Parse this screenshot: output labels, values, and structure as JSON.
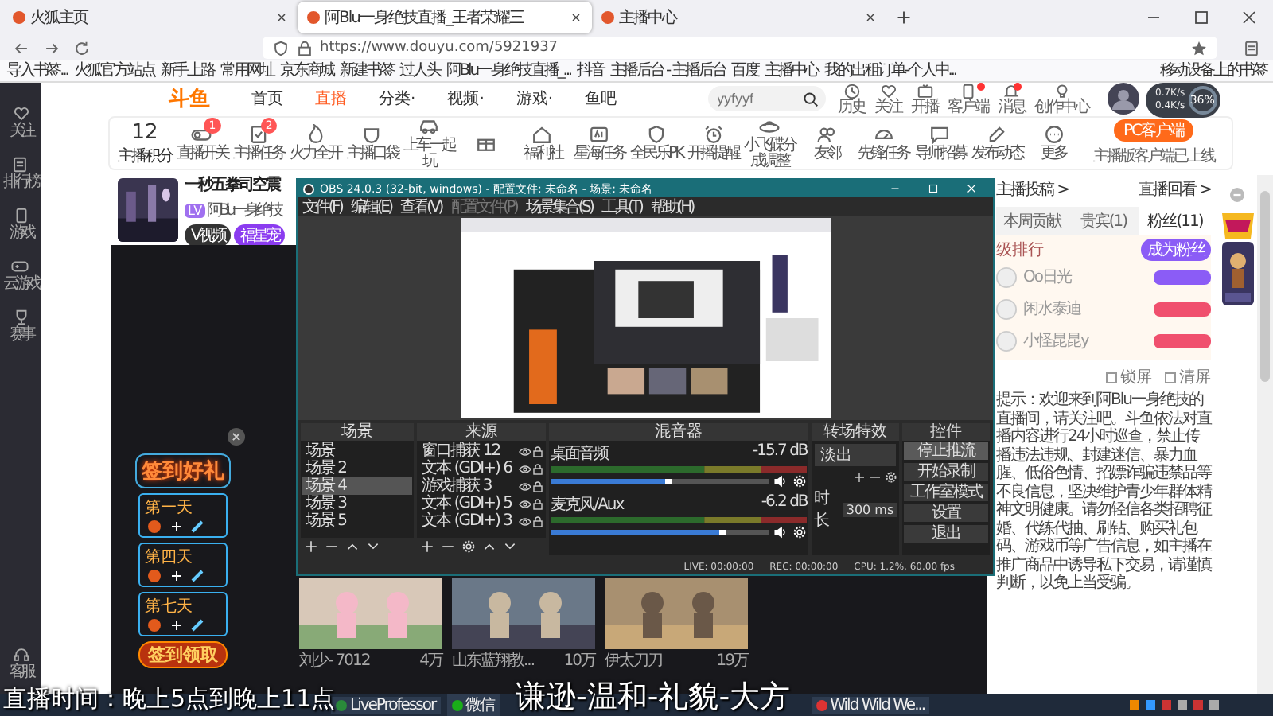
{
  "browser": {
    "tabs": [
      {
        "label": "火狐主页",
        "selected": false
      },
      {
        "label": "阿Blu一身绝技直播_王者荣耀三",
        "selected": true
      },
      {
        "label": "主播中心",
        "selected": false
      }
    ],
    "url": "https://www.douyu.com/5921937",
    "bookmarks": [
      "导入书签...",
      "火狐官方站点",
      "新手上路",
      "常用网址",
      "京东商城",
      "新建书签",
      "过人头",
      "阿Blu一身绝技直播_...",
      "抖音",
      "主播后台 - 主播后台",
      "百度",
      "主播中心",
      "我的出租订单-个人中..."
    ],
    "mobile_bookmarks": "移动设备上的书签"
  },
  "site": {
    "logo": "斗鱼",
    "nav": [
      {
        "label": "首页",
        "selected": false
      },
      {
        "label": "直播",
        "selected": true
      },
      {
        "label": "分类·",
        "selected": false
      },
      {
        "label": "视频·",
        "selected": false
      },
      {
        "label": "游戏·",
        "selected": false
      },
      {
        "label": "鱼吧",
        "selected": false
      }
    ],
    "search": {
      "placeholder": "yyfyyf"
    },
    "header_links": [
      {
        "label": "历史",
        "badge": false
      },
      {
        "label": "关注",
        "badge": false
      },
      {
        "label": "开播",
        "badge": false
      },
      {
        "label": "客户端",
        "badge": true
      },
      {
        "label": "消息",
        "badge": true
      },
      {
        "label": "创作中心",
        "badge": false
      }
    ]
  },
  "sidebar": {
    "items": [
      {
        "label": "关注"
      },
      {
        "label": "排行榜"
      },
      {
        "label": "游戏"
      },
      {
        "label": "云游戏"
      },
      {
        "label": "赛事"
      },
      {
        "label": "客服"
      }
    ]
  },
  "toolbar": {
    "score": "12",
    "score_label": "主播积分",
    "items": [
      {
        "kind": "labeled",
        "label": "直播开关",
        "badge": "1"
      },
      {
        "kind": "labeled",
        "label": "主播任务",
        "badge": "2"
      },
      {
        "kind": "labeled",
        "label": "火力全开"
      },
      {
        "kind": "labeled",
        "label": "主播口袋"
      },
      {
        "kind": "labeled",
        "label": "上车一起玩"
      },
      {
        "kind": "icon"
      },
      {
        "kind": "labeled",
        "label": "福利社"
      },
      {
        "kind": "labeled",
        "label": "星海任务"
      },
      {
        "kind": "labeled",
        "label": "全民乐PK"
      },
      {
        "kind": "labeled",
        "label": "开播提醒"
      },
      {
        "kind": "labeled",
        "label": "小飞碟分成调整"
      },
      {
        "kind": "labeled",
        "label": "友邻"
      },
      {
        "kind": "labeled",
        "label": "先锋任务"
      },
      {
        "kind": "labeled",
        "label": "导师招募"
      },
      {
        "kind": "labeled",
        "label": "发布动态"
      },
      {
        "kind": "labeled",
        "label": "更多"
      }
    ],
    "client_button": "PC客户端",
    "client_note": "主播版客户端已上线"
  },
  "room": {
    "title": "一秒五拳司空震",
    "streamer": "阿Blu一身绝技",
    "level": "LV",
    "tags": [
      "V视频",
      "福星宠"
    ]
  },
  "gift_panel": {
    "title": "签到好礼",
    "days": [
      "第一天",
      "第四天",
      "第七天"
    ],
    "button": "签到领取"
  },
  "recommended": [
    {
      "author": "刘少- 7012",
      "views": "4万"
    },
    {
      "author": "山东蓝翔教...",
      "views": "10万"
    },
    {
      "author": "伊太刀刀",
      "views": "19万"
    }
  ],
  "obs": {
    "title": "OBS 24.0.3 (32-bit, windows) - 配置文件: 未命名 - 场景: 未命名",
    "menu": [
      {
        "label": "文件(F)",
        "disabled": false
      },
      {
        "label": "编辑(E)",
        "disabled": false
      },
      {
        "label": "查看(V)",
        "disabled": false
      },
      {
        "label": "配置文件(P)",
        "disabled": true
      },
      {
        "label": "场景集合(S)",
        "disabled": false
      },
      {
        "label": "工具(T)",
        "disabled": false
      },
      {
        "label": "帮助(H)",
        "disabled": false
      }
    ],
    "docks": [
      "场景",
      "来源",
      "混音器",
      "转场特效",
      "控件"
    ],
    "scenes": [
      {
        "label": "场景",
        "selected": false
      },
      {
        "label": "场景 2",
        "selected": false
      },
      {
        "label": "场景 4",
        "selected": true
      },
      {
        "label": "场景 3",
        "selected": false
      },
      {
        "label": "场景 5",
        "selected": false
      }
    ],
    "sources": [
      "窗口捕获 12",
      "文本 (GDI+) 6",
      "游戏捕获 3",
      "文本 (GDI+) 5",
      "文本 (GDI+) 3"
    ],
    "channels": [
      {
        "name": "桌面音频",
        "reading": "-15.7 dB",
        "level": 0.55
      },
      {
        "name": "麦克风/Aux",
        "reading": "-6.2 dB",
        "level": 0.8
      }
    ],
    "transition": {
      "value": "淡出",
      "duration_label": "时长",
      "duration": "300 ms"
    },
    "controls": [
      {
        "label": "停止推流",
        "active": true
      },
      {
        "label": "开始录制",
        "active": false
      },
      {
        "label": "工作室模式",
        "active": false
      },
      {
        "label": "设置",
        "active": false
      },
      {
        "label": "退出",
        "active": false
      }
    ],
    "status": [
      "LIVE: 00:00:00",
      "REC: 00:00:00",
      "CPU: 1.2%, 60.00 fps"
    ]
  },
  "right_panel": {
    "links": [
      "主播投稿 >",
      "直播回看 >"
    ],
    "tabs": [
      {
        "label": "本周贡献",
        "selected": false
      },
      {
        "label": "贵宾(1)",
        "selected": false
      },
      {
        "label": "粉丝(11)",
        "selected": true
      }
    ],
    "rank_title": "级排行",
    "join_button": "成为粉丝",
    "fans": [
      {
        "name": "Oo日光",
        "color": "#8b5cf6"
      },
      {
        "name": "闲水泰迪",
        "color": "#f0506e"
      },
      {
        "name": "小怪昆昆y",
        "color": "#f0506e"
      }
    ],
    "chat_options": [
      {
        "label": "锁屏",
        "checked": false
      },
      {
        "label": "清屏",
        "checked": false
      }
    ],
    "notice": "提示：欢迎来到阿Blu一身绝技的直播间，请关注吧。斗鱼依法对直播内容进行24小时巡查，禁止传播违法违规、封建迷信、暴力血腥、低俗色情、招嫖诈骗违禁品等不良信息，坚决维护青少年群体精神文明健康。请勿轻信各类招聘征婚、代练代抽、刷钻、购买礼包码、游戏币等广告信息，如主播在推广商品中诱导私下交易，请谨慎判断，以免上当受骗。"
  },
  "speed": {
    "percent": "36%",
    "up": "0.7K/s",
    "down": "0.4K/s"
  },
  "taskbar": [
    "LiveProfessor",
    "微信",
    "Wild Wild We..."
  ],
  "subtitles": [
    "直播时间：晚上5点到晚上11点",
    "谦逊-温和-礼貌-大方"
  ]
}
